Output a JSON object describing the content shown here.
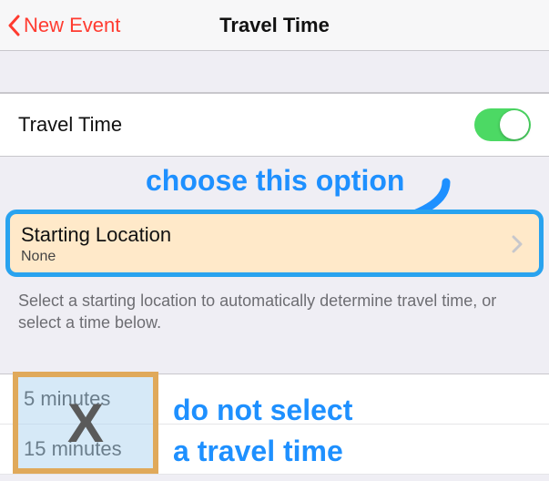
{
  "nav": {
    "back_label": "New Event",
    "title": "Travel Time"
  },
  "travel_time_row": {
    "label": "Travel Time",
    "toggle_on": true
  },
  "starting_location": {
    "title": "Starting Location",
    "value": "None"
  },
  "help_text": "Select a starting location to automatically determine travel time, or select a time below.",
  "time_options": {
    "option1": "5 minutes",
    "option2": "15 minutes"
  },
  "annotations": {
    "choose": "choose this option",
    "donot_line1": "do not select",
    "donot_line2": "a travel time",
    "x_mark": "X"
  }
}
